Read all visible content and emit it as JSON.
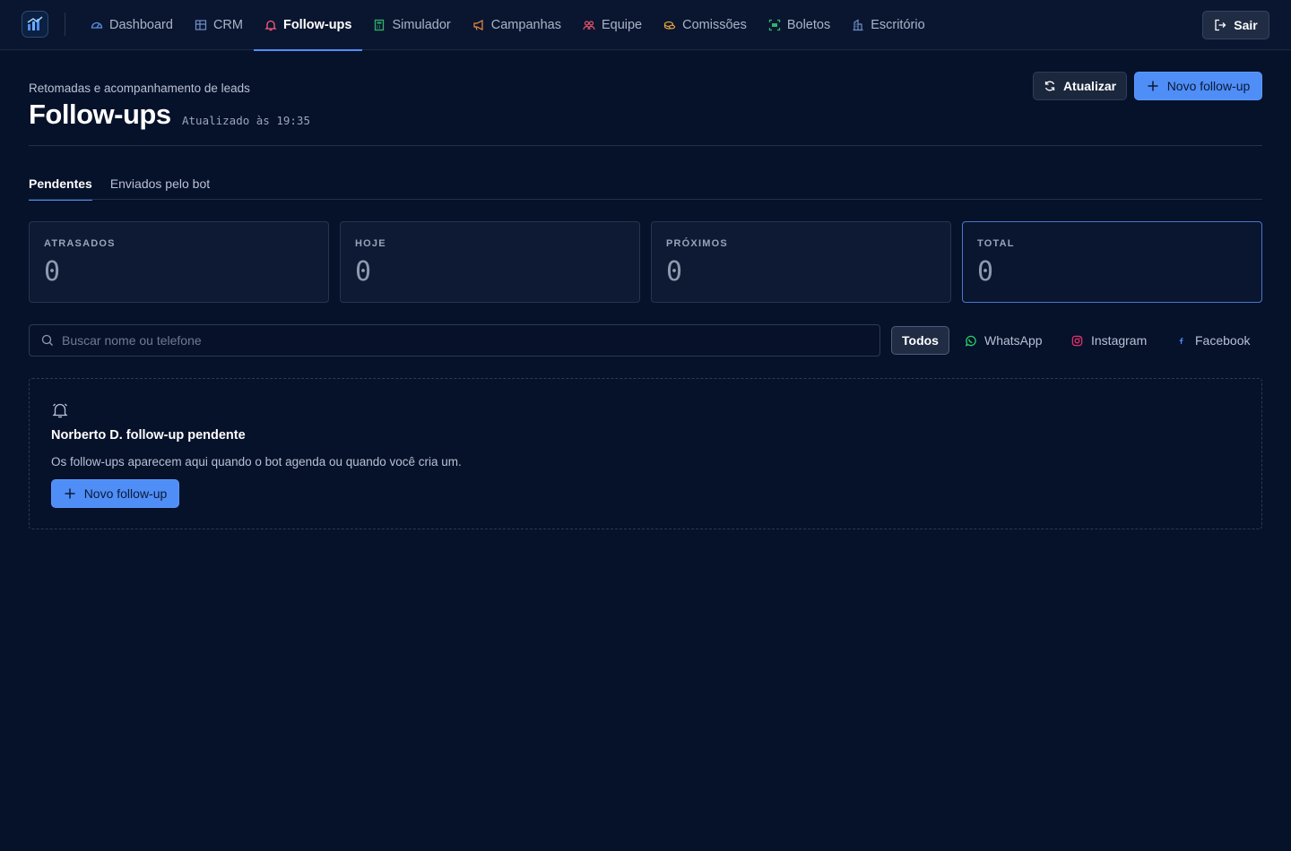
{
  "nav": {
    "items": [
      {
        "label": "Dashboard",
        "icon": "gauge-icon"
      },
      {
        "label": "CRM",
        "icon": "grid-icon"
      },
      {
        "label": "Follow-ups",
        "icon": "bell-icon",
        "active": true
      },
      {
        "label": "Simulador",
        "icon": "calculator-icon"
      },
      {
        "label": "Campanhas",
        "icon": "megaphone-icon"
      },
      {
        "label": "Equipe",
        "icon": "users-icon"
      },
      {
        "label": "Comissões",
        "icon": "coins-icon"
      },
      {
        "label": "Boletos",
        "icon": "scan-icon"
      },
      {
        "label": "Escritório",
        "icon": "building-icon"
      }
    ],
    "logout_label": "Sair"
  },
  "header": {
    "subtitle": "Retomadas e acompanhamento de leads",
    "title": "Follow-ups",
    "updated": "Atualizado às 19:35",
    "refresh_label": "Atualizar",
    "new_label": "Novo follow-up"
  },
  "tabs": [
    {
      "label": "Pendentes",
      "active": true
    },
    {
      "label": "Enviados pelo bot",
      "active": false
    }
  ],
  "stats": [
    {
      "label": "ATRASADOS",
      "value": "0"
    },
    {
      "label": "HOJE",
      "value": "0"
    },
    {
      "label": "PRÓXIMOS",
      "value": "0"
    },
    {
      "label": "TOTAL",
      "value": "0",
      "selected": true
    }
  ],
  "search": {
    "placeholder": "Buscar nome ou telefone",
    "value": ""
  },
  "filters": [
    {
      "label": "Todos",
      "active": true
    },
    {
      "label": "WhatsApp",
      "icon": "whatsapp-icon",
      "color": "#25d366"
    },
    {
      "label": "Instagram",
      "icon": "instagram-icon",
      "color": "#e1306c"
    },
    {
      "label": "Facebook",
      "icon": "facebook-icon",
      "color": "#4f8ef7"
    }
  ],
  "empty_state": {
    "title": "Norberto D. follow-up pendente",
    "description": "Os follow-ups aparecem aqui quando o bot agenda ou quando você cria um.",
    "button_label": "Novo follow-up"
  },
  "colors": {
    "background": "#06112a",
    "accent": "#4f8ef7",
    "nav_active_icon": "#ff5a7a"
  }
}
